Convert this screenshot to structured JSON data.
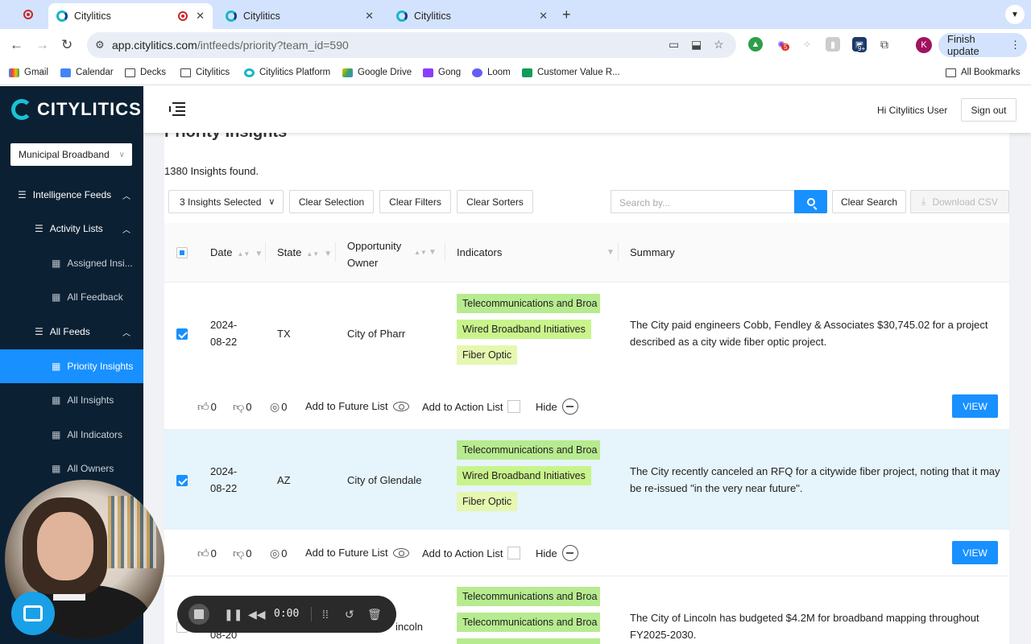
{
  "browser": {
    "tabs": [
      {
        "title": "Citylitics",
        "active": true
      },
      {
        "title": "Citylitics",
        "active": false
      },
      {
        "title": "Citylitics",
        "active": false
      }
    ],
    "url_host": "app.citylitics.com",
    "url_path": "/intfeeds/priority?team_id=590",
    "profile_initial": "K",
    "finish_update": "Finish update",
    "ext_badges": {
      "b1": "5",
      "b2": "9+"
    },
    "bookmarks": [
      "Gmail",
      "Calendar",
      "Decks",
      "Citylitics",
      "Citylitics Platform",
      "Google Drive",
      "Gong",
      "Loom",
      "Customer Value R..."
    ],
    "all_bookmarks": "All Bookmarks"
  },
  "sidebar": {
    "brand": "CITYLITICS",
    "team": "Municipal Broadband",
    "items": [
      {
        "label": "Intelligence Feeds"
      },
      {
        "label": "Activity Lists"
      },
      {
        "label": "Assigned Insi..."
      },
      {
        "label": "All Feedback"
      },
      {
        "label": "All Feeds"
      },
      {
        "label": "Priority Insights"
      },
      {
        "label": "All Insights"
      },
      {
        "label": "All Indicators"
      },
      {
        "label": "All Owners"
      }
    ]
  },
  "header": {
    "greeting": "Hi Citylitics User",
    "sign_out": "Sign out"
  },
  "page": {
    "title": "Priority Insights",
    "count_text": "1380 Insights found.",
    "toolbar": {
      "selected": "3 Insights Selected",
      "clear_selection": "Clear Selection",
      "clear_filters": "Clear Filters",
      "clear_sorters": "Clear Sorters",
      "search_placeholder": "Search by...",
      "clear_search": "Clear Search",
      "download_csv": "Download CSV"
    },
    "columns": {
      "date": "Date",
      "state": "State",
      "owner_line1": "Opportunity",
      "owner_line2": "Owner",
      "indicators": "Indicators",
      "summary": "Summary"
    },
    "action_labels": {
      "future": "Add to Future List",
      "action": "Add to Action List",
      "hide": "Hide",
      "view": "VIEW"
    },
    "rows": [
      {
        "date_l1": "2024-",
        "date_l2": "08-22",
        "state": "TX",
        "owner": "City of Pharr",
        "indicators": [
          "Telecommunications and Broa",
          "Wired Broadband Initiatives",
          "Fiber Optic"
        ],
        "summary": "The City paid engineers Cobb, Fendley & Associates $30,745.02 for a project described as a city wide fiber optic project.",
        "likes": "0",
        "dislikes": "0",
        "targets": "0"
      },
      {
        "date_l1": "2024-",
        "date_l2": "08-22",
        "state": "AZ",
        "owner": "City of Glendale",
        "indicators": [
          "Telecommunications and Broa",
          "Wired Broadband Initiatives",
          "Fiber Optic"
        ],
        "summary": "The City recently canceled an RFQ for a citywide fiber project, noting that it may be re-issued \"in the very near future\".",
        "likes": "0",
        "dislikes": "0",
        "targets": "0"
      },
      {
        "date_l1": "",
        "date_l2": "08-20",
        "state": "",
        "owner": "incoln",
        "indicators": [
          "Telecommunications and Broa",
          "Telecommunications and Broa"
        ],
        "summary": "The City of Lincoln has budgeted $4.2M for broadband mapping throughout FY2025-2030."
      }
    ]
  },
  "recorder": {
    "time": "0:00"
  }
}
